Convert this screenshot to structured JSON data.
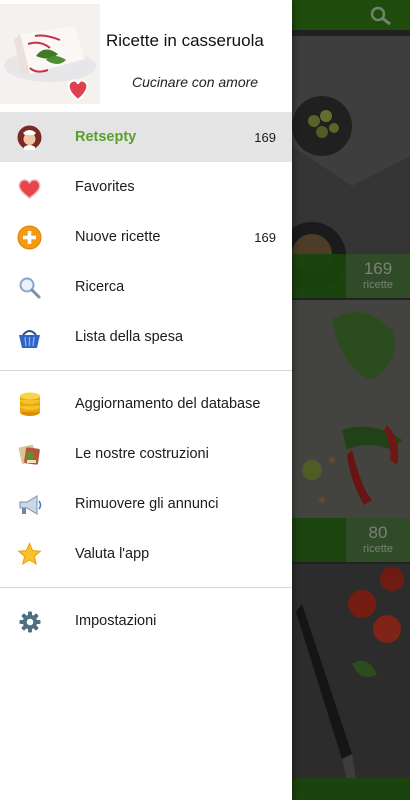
{
  "header": {
    "title": "Ricette in casseruola",
    "subtitle": "Cucinare con amore"
  },
  "menu_main": [
    {
      "label": "Retsepty",
      "count": "169",
      "icon": "chef-avatar-icon",
      "active": true
    },
    {
      "label": "Favorites",
      "count": "",
      "icon": "heart-icon"
    },
    {
      "label": "Nuove ricette",
      "count": "169",
      "icon": "plus-circle-icon"
    },
    {
      "label": "Ricerca",
      "count": "",
      "icon": "magnifier-icon"
    },
    {
      "label": "Lista della spesa",
      "count": "",
      "icon": "shopping-basket-icon"
    }
  ],
  "menu_secondary": [
    {
      "label": "Aggiornamento del database",
      "icon": "database-icon"
    },
    {
      "label": "Le nostre costruzioni",
      "icon": "apps-icon"
    },
    {
      "label": "Rimuovere gli annunci",
      "icon": "megaphone-icon"
    },
    {
      "label": "Valuta l'app",
      "icon": "star-icon"
    }
  ],
  "menu_settings": [
    {
      "label": "Impostazioni",
      "icon": "gear-icon"
    }
  ],
  "background_cards": [
    {
      "count": "169",
      "label": "ricette"
    },
    {
      "count": "80",
      "label": "ricette"
    }
  ],
  "colors": {
    "active_text": "#5aa02c",
    "toolbar": "#2b6a12"
  }
}
